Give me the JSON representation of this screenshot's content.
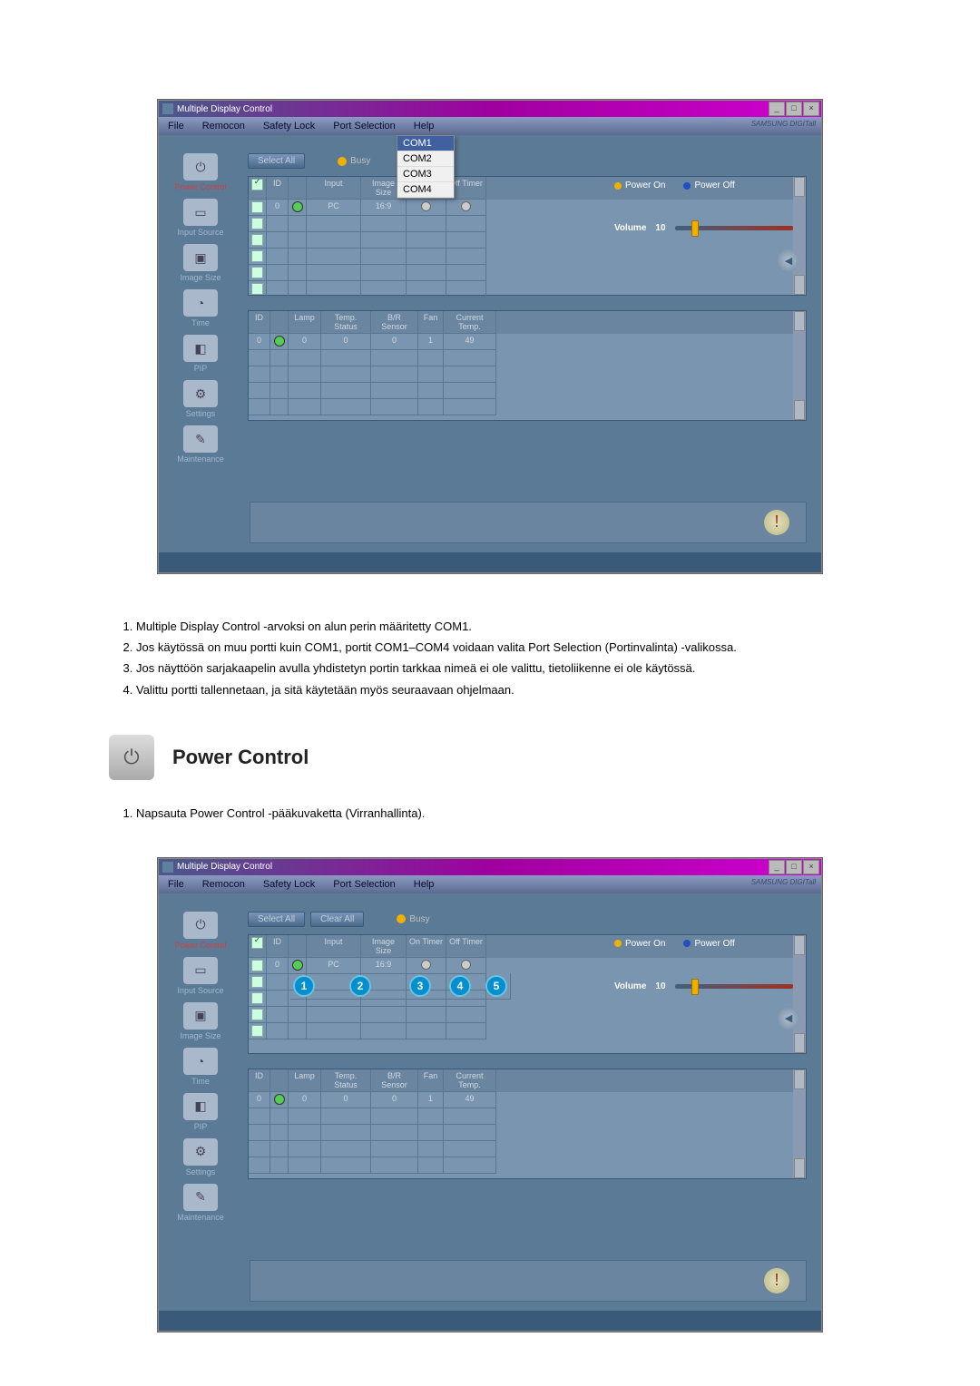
{
  "app": {
    "title": "Multiple Display Control",
    "brand": "SAMSUNG DIGITall",
    "menubar": [
      "File",
      "Remocon",
      "Safety Lock",
      "Port Selection",
      "Help"
    ],
    "port_dropdown": {
      "items": [
        "COM1",
        "COM2",
        "COM3",
        "COM4"
      ],
      "selected": "COM1"
    },
    "sidebar": [
      {
        "label": "Power Control",
        "icon": "⏻",
        "active": true
      },
      {
        "label": "Input Source",
        "icon": "▭"
      },
      {
        "label": "Image Size",
        "icon": "▣"
      },
      {
        "label": "Time",
        "icon": "◔"
      },
      {
        "label": "PIP",
        "icon": "◧"
      },
      {
        "label": "Settings",
        "icon": "⚙"
      },
      {
        "label": "Maintenance",
        "icon": "✎"
      }
    ],
    "buttons": {
      "select_all": "Select All",
      "clear_all": "Clear All"
    },
    "busy": "Busy",
    "grid1": {
      "headers": [
        "",
        "ID",
        "",
        "Input",
        "Image Size",
        "On Timer",
        "Off Timer"
      ],
      "rows": [
        {
          "id": "0",
          "input": "PC",
          "size": "16:9"
        }
      ]
    },
    "grid2": {
      "headers": [
        "ID",
        "",
        "Lamp",
        "Temp. Status",
        "B/R Sensor",
        "Fan",
        "Current Temp."
      ],
      "rows": [
        {
          "id": "0",
          "lamp": "0",
          "temp": "0",
          "br": "0",
          "fan": "1",
          "ct": "49"
        }
      ]
    },
    "power": {
      "on": "Power On",
      "off": "Power Off"
    },
    "volume": {
      "label": "Volume",
      "value": "10"
    }
  },
  "notes": [
    "Multiple Display Control -arvoksi on alun perin määritetty COM1.",
    "Jos käytössä on muu portti kuin COM1, portit COM1–COM4 voidaan valita Port Selection (Portinvalinta) -valikossa.",
    "Jos näyttöön sarjakaapelin avulla yhdistetyn portin tarkkaa nimeä ei ole valittu, tietoliikenne ei ole käytössä.",
    "Valittu portti tallennetaan, ja sitä käytetään myös seuraavaan ohjelmaan."
  ],
  "section": {
    "title": "Power Control"
  },
  "notes2": [
    "Napsauta Power Control -pääkuvaketta (Virranhallinta)."
  ],
  "callouts": [
    "1",
    "2",
    "3",
    "4",
    "5"
  ]
}
